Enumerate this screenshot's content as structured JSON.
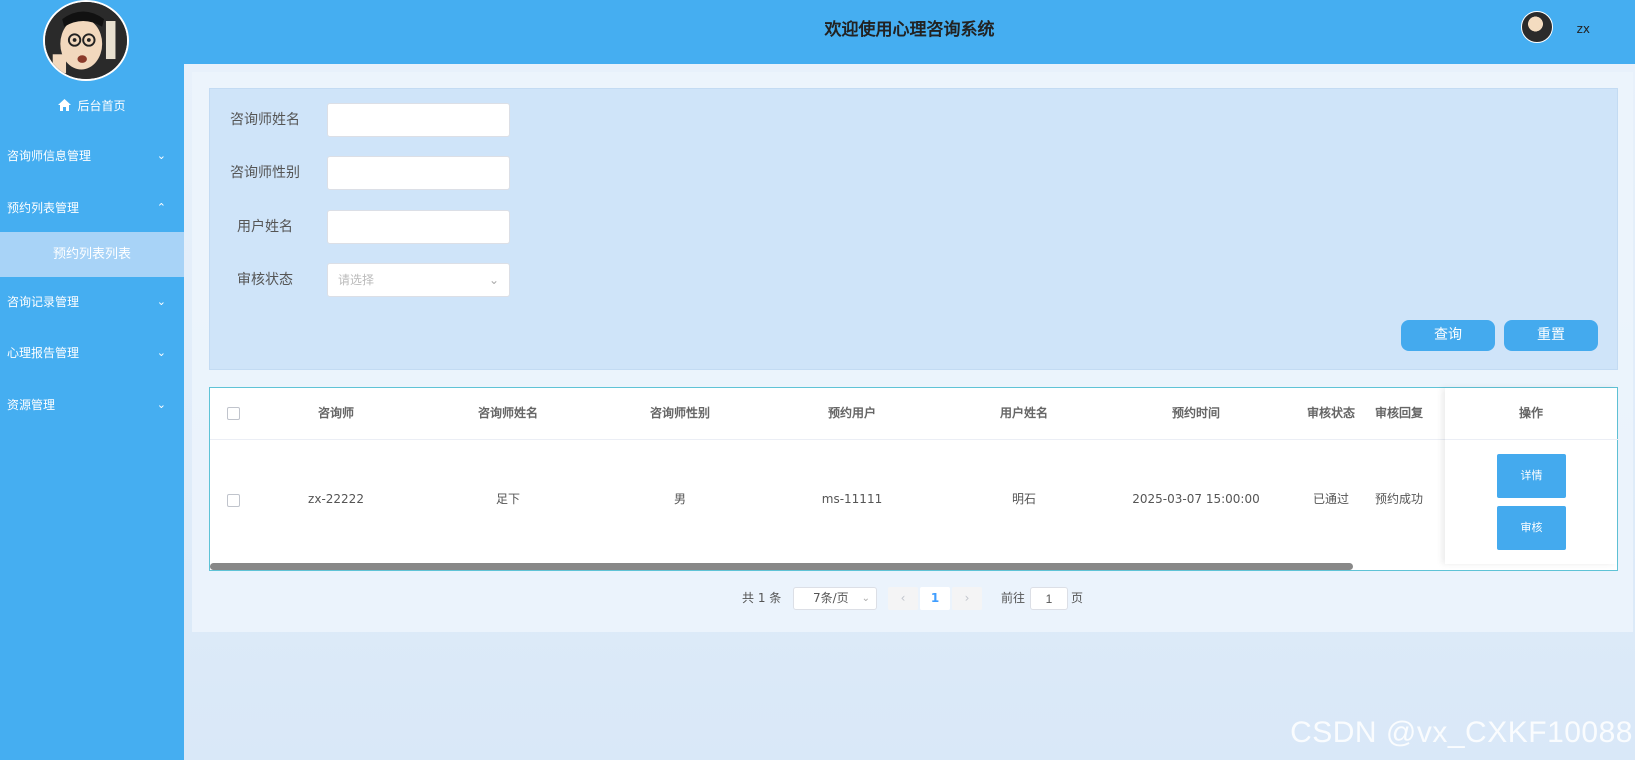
{
  "header": {
    "title": "欢迎使用心理咨询系统",
    "user_name": "zx"
  },
  "sidebar": {
    "home_label": "后台首页",
    "items": [
      {
        "label": "咨询师信息管理",
        "expanded": false
      },
      {
        "label": "预约列表管理",
        "expanded": true
      },
      {
        "label": "咨询记录管理",
        "expanded": false
      },
      {
        "label": "心理报告管理",
        "expanded": false
      },
      {
        "label": "资源管理",
        "expanded": false
      }
    ],
    "subitem_active": "预约列表列表"
  },
  "search": {
    "fields": [
      {
        "label": "咨询师姓名",
        "value": ""
      },
      {
        "label": "咨询师性别",
        "value": ""
      },
      {
        "label": "用户姓名",
        "value": ""
      },
      {
        "label": "审核状态",
        "placeholder": "请选择"
      }
    ],
    "query_label": "查询",
    "reset_label": "重置"
  },
  "table": {
    "headers": [
      "咨询师",
      "咨询师姓名",
      "咨询师性别",
      "预约用户",
      "用户姓名",
      "预约时间",
      "审核状态",
      "审核回复",
      "操作"
    ],
    "rows": [
      {
        "counselor": "zx-22222",
        "counselor_name": "足下",
        "counselor_gender": "男",
        "user": "ms-11111",
        "user_name": "明石",
        "time": "2025-03-07 15:00:00",
        "status": "已通过",
        "reply": "预约成功",
        "actions": [
          "详情",
          "审核"
        ]
      }
    ]
  },
  "pagination": {
    "total_text": "共 1 条",
    "page_size": "7条/页",
    "current_page": "1",
    "goto_label": "前往",
    "goto_value": "1",
    "page_suffix": "页"
  },
  "watermark": "CSDN @vx_CXKF10088",
  "colors": {
    "primary": "#45aef1",
    "button": "#44aaee"
  }
}
